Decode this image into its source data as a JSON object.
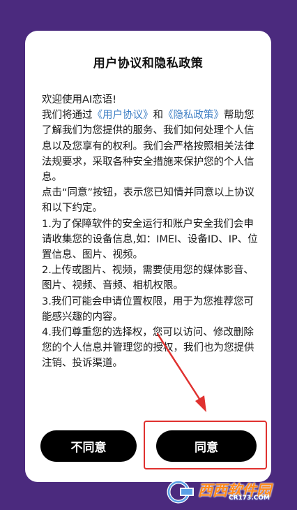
{
  "dialog": {
    "title": "用户协议和隐私政策",
    "greeting": "欢迎使用AI恋语!",
    "intro_prefix": "我们将通过",
    "user_agreement_link": "《用户协议》",
    "and_text": "和",
    "privacy_policy_link": "《隐私政策》",
    "intro_rest": "帮助您了解我们为您提供的服务、我们如何处理个人信息以及您享有的权利。我们会严格按照相关法律法规要求，采取各种安全措施来保护您的个人信息。",
    "consent_note": " 点击“同意”按钮，表示您已知情并同意以上协议和以下约定。",
    "items": [
      " 1.为了保障软件的安全运行和账户安全我们会申请收集您的设备信息,如：IMEI、设备ID、IP、位置信息、图片、视频。",
      " 2.上传或图片、视频，需要使用您的媒体影音、图片、视频、音频、相机权限。",
      " 3.我们可能会申请位置权限，用于为您推荐您可能感兴趣的内容。",
      " 4.我们尊重您的选择权，您可以访问、修改删除您的个人信息并管理您的授权，我们也为您提供注销、投诉渠道。"
    ],
    "decline_label": "不同意",
    "agree_label": "同意"
  },
  "watermark": {
    "brand": "西西软件园",
    "domain": "CR173.COM"
  },
  "colors": {
    "background": "#4b2a7e",
    "link": "#3d7ec4",
    "button": "#000000",
    "annotation": "#e0312f"
  }
}
